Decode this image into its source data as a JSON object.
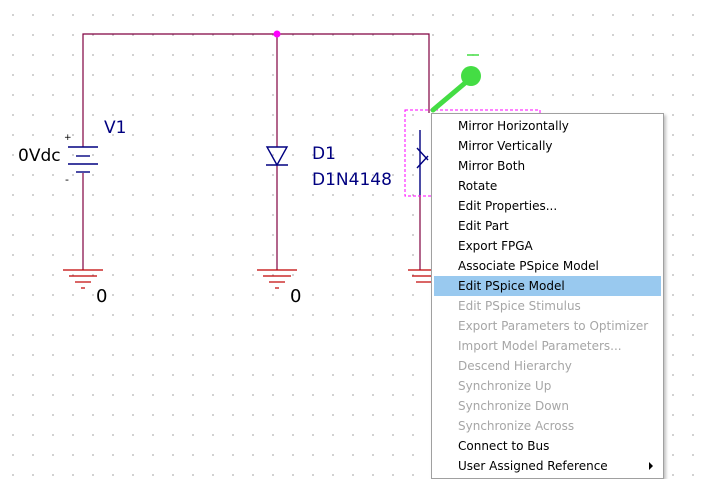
{
  "schematic": {
    "v1_ref": "V1",
    "v1_value": "0Vdc",
    "v1_plus": "+",
    "v1_minus": "-",
    "d1_ref": "D1",
    "d1_part": "D1N4148",
    "gnd1_label": "0",
    "gnd2_label": "0"
  },
  "colors": {
    "wire": "#800040",
    "part": "#000080",
    "ground": "#c00000",
    "junction": "#ff00ff",
    "selection": "#ff00ff",
    "probe": "#44dd44",
    "highlight": "#99c9ef"
  },
  "context_menu": {
    "items": [
      {
        "label": "Mirror Horizontally",
        "enabled": true
      },
      {
        "label": "Mirror Vertically",
        "enabled": true
      },
      {
        "label": "Mirror Both",
        "enabled": true
      },
      {
        "label": "Rotate",
        "enabled": true
      },
      {
        "label": "Edit Properties...",
        "enabled": true
      },
      {
        "label": "Edit Part",
        "enabled": true
      },
      {
        "label": "Export FPGA",
        "enabled": true
      },
      {
        "label": "Associate PSpice Model",
        "enabled": true
      },
      {
        "label": "Edit PSpice Model",
        "enabled": true,
        "highlighted": true
      },
      {
        "label": "Edit PSpice Stimulus",
        "enabled": false
      },
      {
        "label": "Export Parameters to Optimizer",
        "enabled": false
      },
      {
        "label": "Import Model Parameters...",
        "enabled": false
      },
      {
        "label": "Descend Hierarchy",
        "enabled": false
      },
      {
        "label": "Synchronize Up",
        "enabled": false
      },
      {
        "label": "Synchronize Down",
        "enabled": false
      },
      {
        "label": "Synchronize Across",
        "enabled": false
      },
      {
        "label": "Connect to Bus",
        "enabled": true
      },
      {
        "label": "User Assigned Reference",
        "enabled": true,
        "submenu": true
      }
    ]
  }
}
